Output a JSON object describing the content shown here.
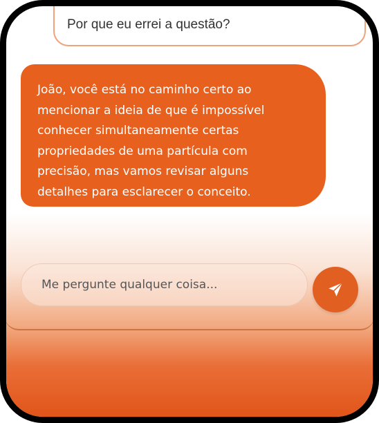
{
  "chat": {
    "user_message": "Por que eu errei a questão?",
    "assistant_lines": [
      "João, você está no caminho certo ao",
      "mencionar a ideia de que é impossível",
      "conhecer simultaneamente certas",
      "propriedades de uma partícula com",
      "precisão, mas vamos revisar alguns",
      "detalhes para esclarecer o conceito."
    ]
  },
  "composer": {
    "placeholder": "Me pergunte qualquer coisa...",
    "send_icon": "send-icon"
  },
  "colors": {
    "accent": "#e8601e",
    "frame": "#000000",
    "user_bubble_border": "#f0a27a"
  }
}
